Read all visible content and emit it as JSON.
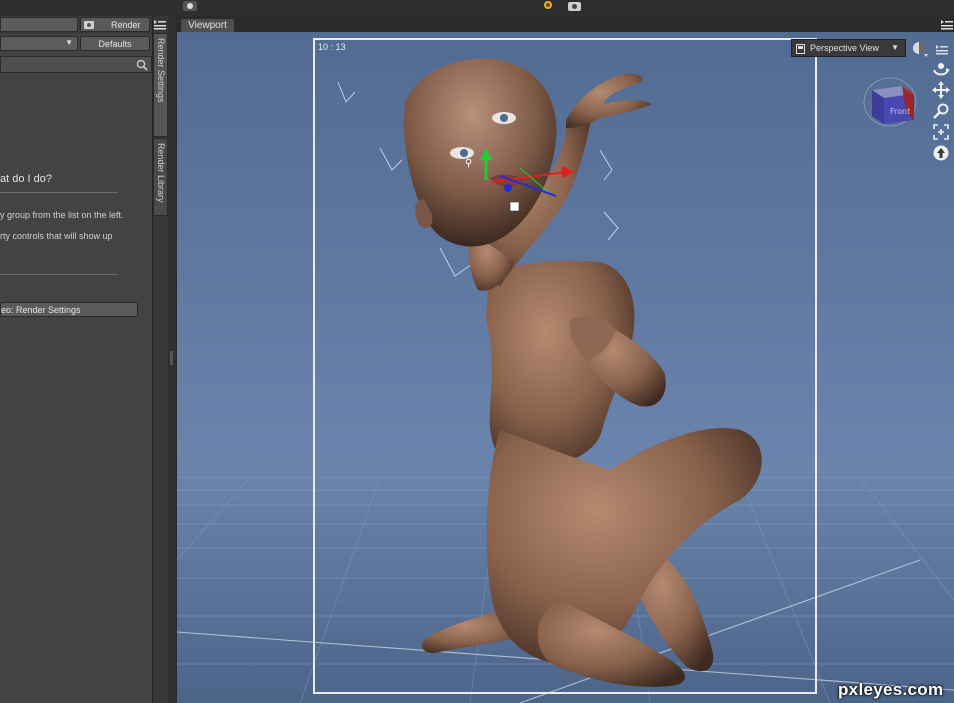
{
  "left_panel": {
    "render_label": "Render",
    "defaults_label": "Defaults",
    "help_heading": "at do I do?",
    "help_line1": "y group from the list on the left.",
    "help_line2": "rty controls that will show up",
    "video_button_label": "eo: Render Settings"
  },
  "vertical_tabs": {
    "render_settings": "Render Settings",
    "render_library": "Render Library"
  },
  "viewport": {
    "tab_label": "Viewport",
    "aspect_label": "10 : 13",
    "view_selector": "Perspective View",
    "cube_face_label": "Front"
  },
  "colors": {
    "viewport_bg": "#55709a",
    "panel_bg": "#434343",
    "frame": "#e8ecf2",
    "skin": "#9a6f57"
  },
  "icons": {
    "top": [
      "camera-icon",
      "sun-render-icon",
      "camera-settings-icon"
    ],
    "nav": [
      "orbit-icon",
      "pan-icon",
      "zoom-icon",
      "frame-icon",
      "reset-view-icon"
    ]
  },
  "watermark": "pxleyes.com"
}
